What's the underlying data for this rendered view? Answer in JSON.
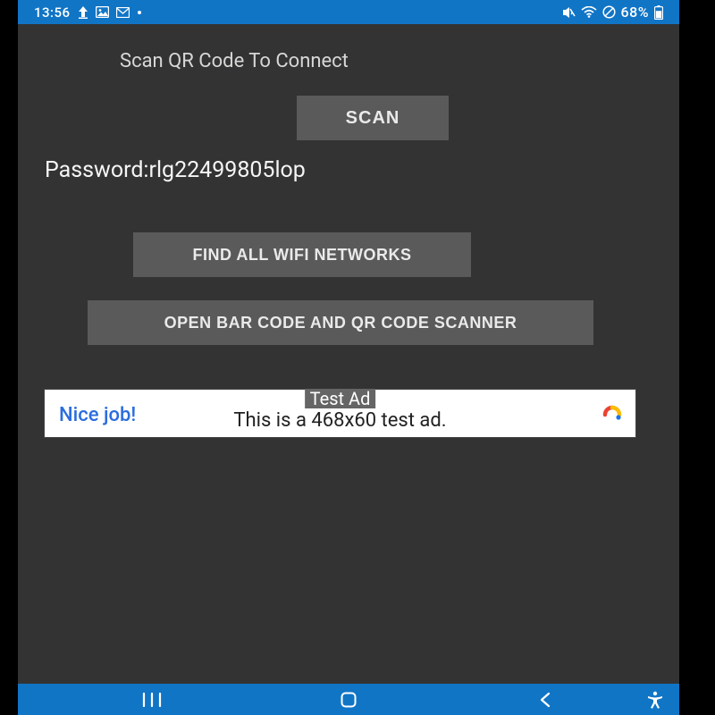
{
  "status": {
    "time": "13:56",
    "battery_pct": "68%"
  },
  "screen": {
    "heading": "Scan QR Code To Connect",
    "scan_label": "SCAN",
    "password_label": "Password:rlg22499805lop",
    "find_label": "FIND ALL WIFI NETWORKS",
    "open_label": "OPEN BAR CODE AND QR CODE SCANNER"
  },
  "ad": {
    "tag": "Test Ad",
    "left": "Nice job!",
    "text": "This is a 468x60 test ad."
  }
}
